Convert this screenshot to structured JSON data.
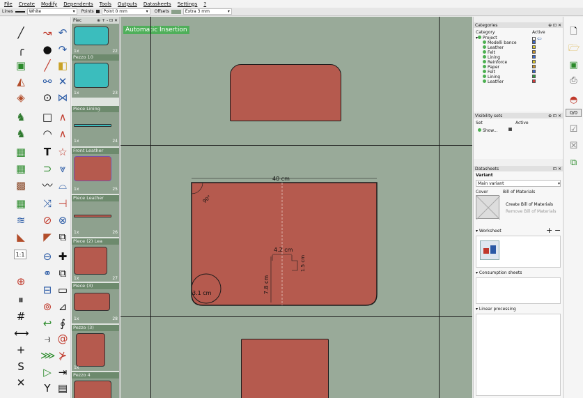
{
  "menubar": {
    "items": [
      "File",
      "Create",
      "Modify",
      "Dependents",
      "Tools",
      "Outputs",
      "Datasheets",
      "Settings",
      "?"
    ]
  },
  "toolbar": {
    "lines_label": "Lines",
    "lines_value": "White",
    "points_label": "Points",
    "points_value": "Point 0 mm",
    "offsets_label": "Offsets",
    "offsets_value": "Extra 3 mm"
  },
  "pieces_panel": {
    "title": "Piec",
    "header_controls": "⊕ + - ⊡ ✕",
    "items": [
      {
        "title": "",
        "count": "1x",
        "number": "22"
      },
      {
        "title": "Pezzo 10",
        "count": "1x",
        "number": "23"
      },
      {
        "title": "Piece Lining",
        "count": "1x",
        "number": "24"
      },
      {
        "title": "Front Leather",
        "count": "1x",
        "number": "25"
      },
      {
        "title": "Piece Leather",
        "count": "1x",
        "number": "26"
      },
      {
        "title": "Piece (2) Lea",
        "count": "1x",
        "number": "27"
      },
      {
        "title": "Piece (3)",
        "count": "1x",
        "number": "28"
      },
      {
        "title": "Pezzo (3)",
        "count": "1x",
        "number": ""
      },
      {
        "title": "Pezzo 4",
        "count": "",
        "number": ""
      }
    ]
  },
  "canvas": {
    "badge": "Automatic Insertion",
    "dimension_width": "40 cm",
    "dimension_inner": "4.2 cm",
    "dimension_vertical": "7.8 cm",
    "dimension_small": "1.5 cm",
    "angle_label": "90°",
    "radius_label": "3.1 cm"
  },
  "colors": {
    "canvas_bg": "#99aa99",
    "piece_fill": "#b55a4e",
    "accent_green": "#4faf5a"
  },
  "categories_panel": {
    "title": "Categories",
    "col_category": "Category",
    "col_active": "Active",
    "root": "Project",
    "items": [
      "Modelli bance",
      "Leather",
      "Felt",
      "Lining",
      "Reinforce",
      "Paper",
      "Felt",
      "Lining",
      "Leather"
    ],
    "colors": [
      "#3b67c9",
      "#d8c52a",
      "#c7932d",
      "#3b67c9",
      "#d8c52a",
      "#c7932d",
      "#3b67c9",
      "#2a9a3d",
      "#d23838"
    ]
  },
  "visibility_panel": {
    "title": "Visibility sets",
    "col_set": "Set",
    "col_active": "Active",
    "item": "Show..."
  },
  "datasheets_panel": {
    "title": "Datasheets",
    "variant_label": "Variant",
    "variant_value": "Main variant",
    "cover_label": "Cover",
    "bom_label": "Bill of Materials",
    "create_bom": "Create Bill of Materials",
    "remove_bom": "Remove Bill of Materials",
    "worksheet": "Worksheet",
    "consumption": "Consumption sheets",
    "linear": "Linear processing"
  },
  "strip": {
    "counter": "0/0"
  }
}
